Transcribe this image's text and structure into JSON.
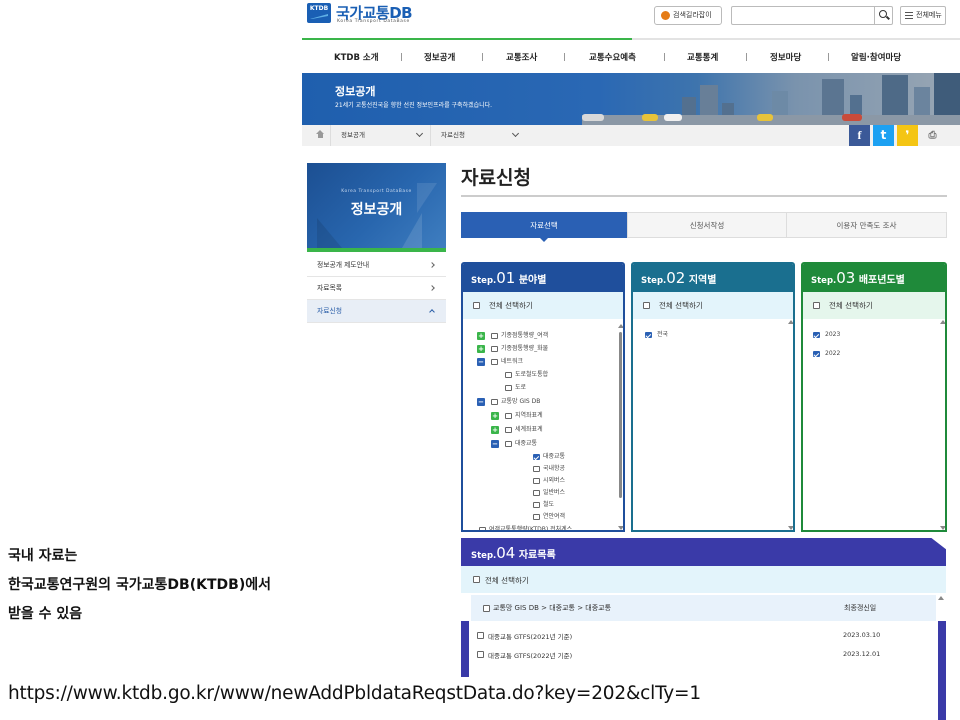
{
  "header": {
    "logo_mark": "KTDB",
    "logo_title": "국가교통DB",
    "logo_subtitle": "Korea Transport DataBase",
    "map_button": "검색길라잡이",
    "search_placeholder": "",
    "menu_button": "전체메뉴"
  },
  "gnb": [
    "KTDB 소개",
    "정보공개",
    "교통조사",
    "교통수요예측",
    "교통통계",
    "정보마당",
    "알림·참여마당"
  ],
  "banner": {
    "title": "정보공개",
    "subtitle": "21세기 교통선진국을 향한 선진 정보인프라를 구축하겠습니다."
  },
  "breadcrumb": [
    "정보공개",
    "자료신청"
  ],
  "share": {
    "facebook": "f",
    "twitter": "t",
    "talk": "❜"
  },
  "sidebar": {
    "subtitle": "Korea Transport DataBase",
    "title": "정보공개",
    "items": [
      {
        "label": "정보공개 제도안내",
        "active": false
      },
      {
        "label": "자료목록",
        "active": false
      },
      {
        "label": "자료신청",
        "active": true
      }
    ]
  },
  "page_title": "자료신청",
  "tabs": [
    "자료선택",
    "신청서작성",
    "이용자 만족도 조사"
  ],
  "steps": [
    {
      "label": "Step.",
      "num": "01",
      "title": "분야별",
      "select_all": "전체 선택하기",
      "color": "#1f4f9c"
    },
    {
      "label": "Step.",
      "num": "02",
      "title": "지역별",
      "select_all": "전체 선택하기",
      "color": "#1a6f8f"
    },
    {
      "label": "Step.",
      "num": "03",
      "title": "배포년도별",
      "select_all": "전체 선택하기",
      "color": "#1f8a3a"
    }
  ],
  "tree": [
    {
      "label": "기종점통행량_여객",
      "toggle": "+",
      "checked": false
    },
    {
      "label": "기종점통행량_화물",
      "toggle": "+",
      "checked": false
    },
    {
      "label": "네트워크",
      "toggle": "−",
      "checked": false
    },
    {
      "label": "도로철도통합",
      "toggle": "",
      "checked": false
    },
    {
      "label": "도로",
      "toggle": "",
      "checked": false
    },
    {
      "label": "교통망 GIS DB",
      "toggle": "−",
      "checked": false
    },
    {
      "label": "지역좌표계",
      "toggle": "+",
      "checked": false
    },
    {
      "label": "세계좌표계",
      "toggle": "+",
      "checked": false
    },
    {
      "label": "대중교통",
      "toggle": "−",
      "checked": false
    },
    {
      "label": "대중교통",
      "toggle": "",
      "checked": true
    },
    {
      "label": "국내항공",
      "toggle": "",
      "checked": false
    },
    {
      "label": "시외버스",
      "toggle": "",
      "checked": false
    },
    {
      "label": "일반버스",
      "toggle": "",
      "checked": false
    },
    {
      "label": "철도",
      "toggle": "",
      "checked": false
    },
    {
      "label": "연안여객",
      "toggle": "",
      "checked": false
    },
    {
      "label": "여객교통통행량(KTDB) 전처계스",
      "toggle": "",
      "checked": false
    }
  ],
  "regions": [
    {
      "label": "전국",
      "checked": true
    }
  ],
  "years": [
    {
      "label": "2023",
      "checked": true
    },
    {
      "label": "2022",
      "checked": true
    }
  ],
  "step4": {
    "label": "Step.",
    "num": "04",
    "title": "자료목록",
    "select_all": "전체 선택하기",
    "path": "교통망 GIS DB > 대중교통 > 대중교통",
    "date_header": "최종갱신일",
    "rows": [
      {
        "name": "대중교통 GTFS(2021년 기준)",
        "date": "2023.03.10"
      },
      {
        "name": "대중교통 GTFS(2022년 기준)",
        "date": "2023.12.01"
      }
    ]
  },
  "caption": {
    "line1": "국내 자료는",
    "line2": "한국교통연구원의 국가교통DB(KTDB)에서",
    "line3": "받을 수 있음"
  },
  "url": "https://www.ktdb.go.kr/www/newAddPbldataReqstData.do?key=202&clTy=1"
}
